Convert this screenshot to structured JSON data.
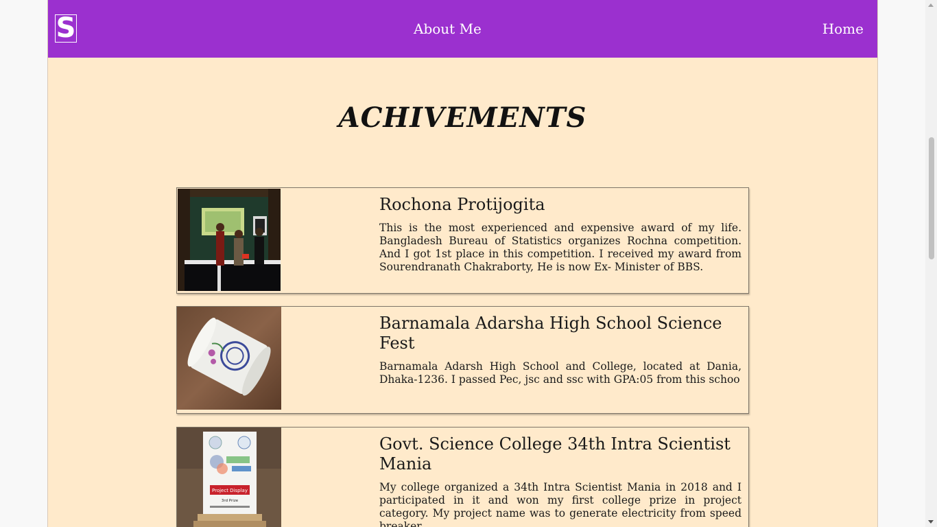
{
  "nav": {
    "logo": "S",
    "about_label": "About Me",
    "home_label": "Home"
  },
  "section": {
    "title": "ACHIVEMENTS"
  },
  "achievements": [
    {
      "title": "Rochona Protijogita",
      "text": "This is the most experienced and expensive award of my life. Bangladesh Bureau of Statistics organizes Rochna competition. And I got 1st place in this competition. I received my award from Sourendranath Chakraborty, He is now Ex- Minister of BBS.",
      "image": "award-ceremony-photo"
    },
    {
      "title": "Barnamala Adarsha High School Science Fest",
      "text": "Barnamala Adarsh High School and College, located at Dania, Dhaka-1236. I passed Pec, jsc and ssc with GPA:05 from this schoo",
      "image": "school-cup-photo"
    },
    {
      "title": "Govt. Science College 34th Intra Scientist Mania",
      "text": "My college organized a 34th Intra Scientist Mania in 2018 and I participated in it and won my first college prize in project category. My project name was to generate electricity from speed breaker",
      "image": "project-display-trophy-photo",
      "trophy_badge": "Project Display",
      "trophy_prize": "3rd Prize"
    }
  ],
  "colors": {
    "navbar": "#9b30cf",
    "background": "#ffeacb"
  }
}
